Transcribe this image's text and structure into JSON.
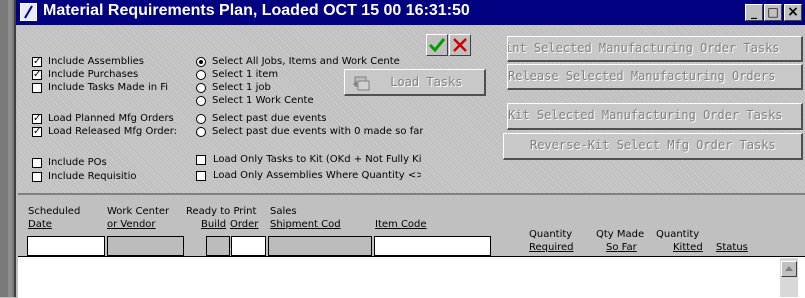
{
  "window": {
    "title": "Material Requirements Plan,  Loaded OCT 15 00  16:31:50",
    "minimize_glyph": "_",
    "maximize_glyph": "□",
    "close_glyph": "×"
  },
  "checkboxes": [
    {
      "label": "Include Assemblies",
      "checked": true
    },
    {
      "label": "Include Purchases",
      "checked": true
    },
    {
      "label": "Include Tasks Made in Fi",
      "checked": false
    },
    {
      "label": "Load Planned Mfg Orders",
      "checked": true
    },
    {
      "label": "Load Released Mfg Order:",
      "checked": true
    },
    {
      "label": "Include POs",
      "checked": false
    },
    {
      "label": "Include Requisitio",
      "checked": false
    }
  ],
  "radios": [
    {
      "label": "Select All Jobs, Items and Work Cente",
      "selected": true
    },
    {
      "label": "Select 1 item",
      "selected": false
    },
    {
      "label": "Select 1 job",
      "selected": false
    },
    {
      "label": "Select 1 Work Cente",
      "selected": false
    },
    {
      "label": "Select past due events",
      "selected": false
    },
    {
      "label": "Select past due events with 0 made so far",
      "selected": false
    }
  ],
  "kit_checkboxes": [
    {
      "label": "Load Only Tasks to Kit (OKd + Not Fully Kitt",
      "checked": false
    },
    {
      "label": "Load Only Assemblies Where Quantity <> Lot S",
      "checked": false
    }
  ],
  "load_tasks_label": "Load Tasks",
  "right_buttons": [
    "int Selected Manufacturing Order Tasks",
    "Release Selected Manufacturing Orders",
    "Kit Selected Manufacturing Order Tasks",
    "Reverse-Kit Select Mfg Order Tasks"
  ],
  "headers": {
    "scheduled": "Scheduled",
    "date": "Date",
    "work_center": "Work Center",
    "or_vendor": "or Vendor",
    "ready_to_print": "Ready to Print",
    "build": "Build",
    "order": "Order",
    "sales": "Sales",
    "shipment_cod": "Shipment Cod",
    "item_code": "Item Code",
    "quantity": "Quantity",
    "required": "Required",
    "qty_made": "Qty Made",
    "so_far": "So Far",
    "quantity2": "Quantity",
    "kitted": "Kitted",
    "status": "Status"
  },
  "colors": {
    "titlebar": "#000080",
    "check_green": "#00a000",
    "x_red": "#d00000"
  }
}
